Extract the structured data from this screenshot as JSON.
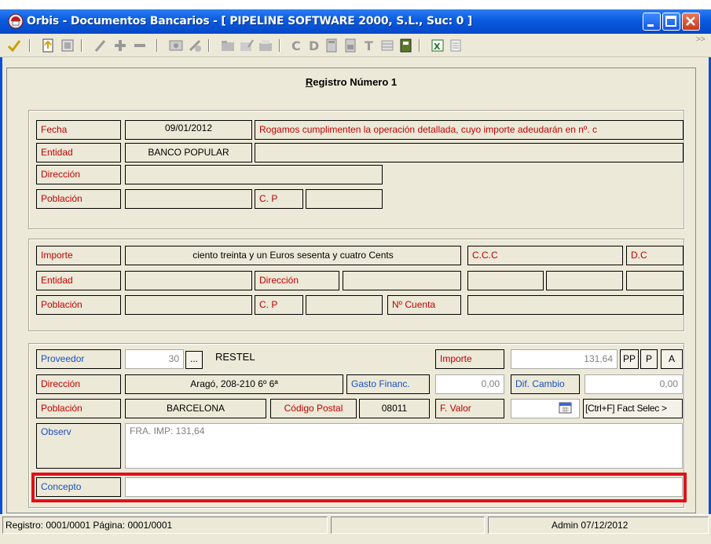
{
  "window": {
    "title": "Orbis - Documentos Bancarios - [ PIPELINE SOFTWARE 2000, S.L.,  Suc: 0 ]",
    "title_icon": "orbis-app-icon",
    "accent": "#0a5be0"
  },
  "toolbar": {
    "icons": [
      "accept-check-icon",
      "document-up-icon",
      "document-icon",
      "pencil-icon",
      "plus-icon",
      "minus-icon",
      "image-icon",
      "print-icon",
      "folder-icon",
      "edit-folder-icon",
      "folder-open-icon",
      "c-icon",
      "d-icon",
      "calc-icon",
      "calc2-icon",
      "t-icon",
      "table-icon",
      "book-icon",
      "excel-icon",
      "list-icon"
    ],
    "chevron": ">>"
  },
  "record": {
    "title_prefix": "R",
    "title_rest": "egistro Número 1"
  },
  "section1": {
    "fecha_label": "Fecha",
    "fecha_value": "09/01/2012",
    "message": "Rogamos cumplimenten la operación detallada, cuyo importe adeudarán en nº. c",
    "entidad_label": "Entidad",
    "entidad_value": "BANCO POPULAR",
    "direccion_label": "Dirección",
    "poblacion_label": "Población",
    "cp_label": "C. P"
  },
  "section2": {
    "importe_label": "Importe",
    "importe_text": "ciento treinta y un Euros sesenta y cuatro Cents",
    "ccc_label": "C.C.C",
    "dc_label": "D.C",
    "entidad_label": "Entidad",
    "direccion_label": "Dirección",
    "poblacion_label": "Población",
    "cp_label": "C. P",
    "ncuenta_label": "Nº Cuenta"
  },
  "section3": {
    "proveedor_label": "Proveedor",
    "proveedor_code": "30",
    "ellipsis_button": "...",
    "proveedor_name": "RESTEL",
    "importe_label": "Importe",
    "importe_value": "131,64",
    "pp_button": "PP",
    "p_button": "P",
    "a_button": "A",
    "direccion_label": "Dirección",
    "direccion_value": "Aragó, 208-210 6º 6ª",
    "gasto_label": "Gasto Financ.",
    "gasto_value": "0,00",
    "dif_label": "Dif. Cambio",
    "dif_value": "0,00",
    "poblacion_label": "Población",
    "poblacion_value": "BARCELONA",
    "cp_label": "Código Postal",
    "cp_value": "08011",
    "fvalor_label": "F. Valor",
    "fact_button": "[Ctrl+F] Fact Selec >",
    "observ_label": "Observ",
    "observ_value": "FRA.    IMP: 131,64",
    "concepto_label": "Concepto",
    "concepto_value": "",
    "highlight_color": "#e0101a"
  },
  "status": {
    "left": "Registro: 0001/0001  Página: 0001/0001",
    "right": "Admin 07/12/2012"
  }
}
